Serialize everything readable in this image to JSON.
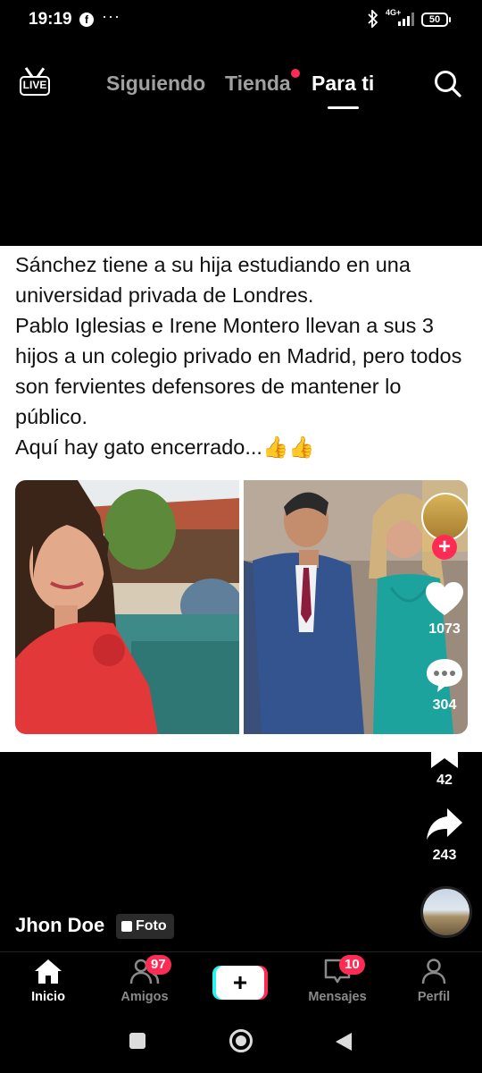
{
  "status_bar": {
    "time": "19:19",
    "facebook_glyph": "f",
    "overflow": "···",
    "bluetooth": "bluetooth-icon",
    "network": "4G+",
    "battery": "50"
  },
  "top_nav": {
    "live_label": "LIVE",
    "tabs": [
      {
        "label": "Siguiendo"
      },
      {
        "label": "Tienda"
      },
      {
        "label": "Para ti"
      }
    ],
    "active_tab": "Para ti"
  },
  "post": {
    "text": "Sánchez tiene a su hija estudiando en una universidad privada de Londres.\nPablo Iglesias e Irene Montero llevan a sus 3 hijos a un colegio privado en Madrid, pero todos son fervientes defensores de mantener lo público.\nAquí hay gato encerrado...👍👍"
  },
  "actions": {
    "follow_glyph": "+",
    "likes": "1073",
    "comments": "304",
    "saves": "42",
    "shares": "243"
  },
  "author": {
    "name": "Jhon Doe",
    "badge": "Foto"
  },
  "bottom_nav": {
    "items": [
      {
        "label": "Inicio"
      },
      {
        "label": "Amigos",
        "badge": "97"
      },
      {
        "label": "Mensajes",
        "badge": "10"
      },
      {
        "label": "Perfil"
      }
    ],
    "create_glyph": "+"
  },
  "colors": {
    "accent": "#fe2c55",
    "cyan": "#25f4ee",
    "background": "#000000"
  }
}
